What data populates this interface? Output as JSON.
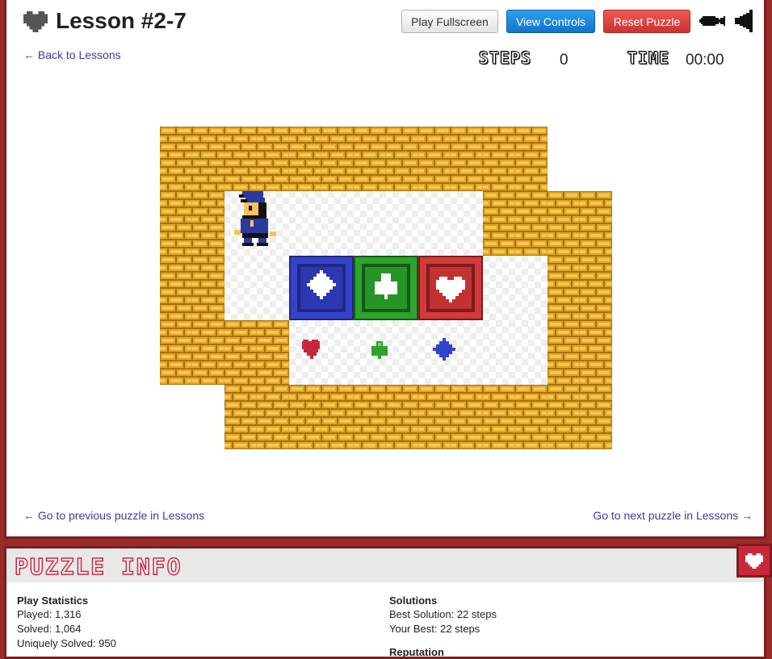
{
  "header": {
    "title": "Lesson #2-7",
    "back_link": "← Back to Lessons",
    "buttons": {
      "fullscreen": "Play Fullscreen",
      "controls": "View Controls",
      "reset": "Reset Puzzle"
    },
    "steps_label": "STEPS",
    "steps_value": "0",
    "time_label": "TIME",
    "time_value": "00:00"
  },
  "board": {
    "grid_cols": 7,
    "grid_rows": 5,
    "boxes": [
      {
        "suit": "diamond",
        "color": "#3344cc"
      },
      {
        "suit": "club",
        "color": "#2ea32e"
      },
      {
        "suit": "heart",
        "color": "#d23a3a"
      }
    ],
    "targets": [
      {
        "suit": "heart",
        "color": "#c8283b"
      },
      {
        "suit": "club",
        "color": "#2ea32e"
      },
      {
        "suit": "diamond",
        "color": "#3344cc"
      }
    ]
  },
  "nav": {
    "prev": "← Go to previous puzzle in Lessons",
    "next": "Go to next puzzle in Lessons →"
  },
  "info": {
    "title": "PUZZLE INFO",
    "play_stats": {
      "heading": "Play Statistics",
      "played": "Played: 1,316",
      "solved": "Solved: 1,064",
      "uniquely": "Uniquely Solved: 950"
    },
    "solutions": {
      "heading": "Solutions",
      "best": "Best Solution: 22 steps",
      "yours": "Your Best: 22 steps",
      "next_heading": "Reputation"
    }
  },
  "colors": {
    "brick": "#e2a526",
    "brick_dark": "#a8701b",
    "frame": "#7a1f1f",
    "accent_red": "#c8283b"
  }
}
